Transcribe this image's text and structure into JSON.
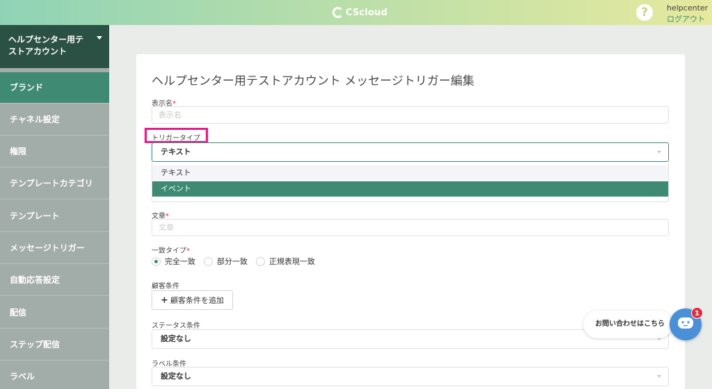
{
  "header": {
    "logo_text": "CScloud",
    "help_label": "?",
    "user_name": "helpcenter",
    "logout_label": "ログアウト"
  },
  "sidebar": {
    "account_name": "ヘルプセンター用テストアカウント",
    "items": [
      {
        "label": "ブランド",
        "active": true
      },
      {
        "label": "チャネル設定"
      },
      {
        "label": "権限"
      },
      {
        "label": "テンプレートカテゴリ"
      },
      {
        "label": "テンプレート"
      },
      {
        "label": "メッセージトリガー"
      },
      {
        "label": "自動応答設定"
      },
      {
        "label": "配信"
      },
      {
        "label": "ステップ配信"
      },
      {
        "label": "ラベル"
      }
    ]
  },
  "main": {
    "title": "ヘルプセンター用テストアカウント メッセージトリガー編集",
    "display_name": {
      "label": "表示名",
      "required_mark": "*",
      "placeholder": "表示名",
      "value": ""
    },
    "trigger_type": {
      "label": "トリガータイプ",
      "selected": "テキスト",
      "options": [
        "テキスト",
        "イベント"
      ],
      "hovered_option": "テキスト",
      "highlighted_option": "イベント"
    },
    "sentence": {
      "label": "文章",
      "required_mark": "*",
      "placeholder": "文章",
      "value": ""
    },
    "match_type": {
      "label": "一致タイプ",
      "required_mark": "*",
      "options": [
        "完全一致",
        "部分一致",
        "正規表現一致"
      ],
      "selected": "完全一致"
    },
    "customer_conditions": {
      "label": "顧客条件",
      "add_button_label": "顧客条件を追加"
    },
    "status_conditions": {
      "label": "ステータス条件",
      "selected": "設定なし"
    },
    "label_conditions": {
      "label": "ラベル条件",
      "selected": "設定なし"
    }
  },
  "chat_widget": {
    "label": "お問い合わせはこちら",
    "badge_count": "1"
  },
  "colors": {
    "accent": "#3e8a73",
    "sidebar_dark": "#2b5044",
    "highlight": "#e61d84",
    "required": "#e0305a",
    "chat_blue": "#4a90d9",
    "badge_red": "#e52b3e"
  }
}
